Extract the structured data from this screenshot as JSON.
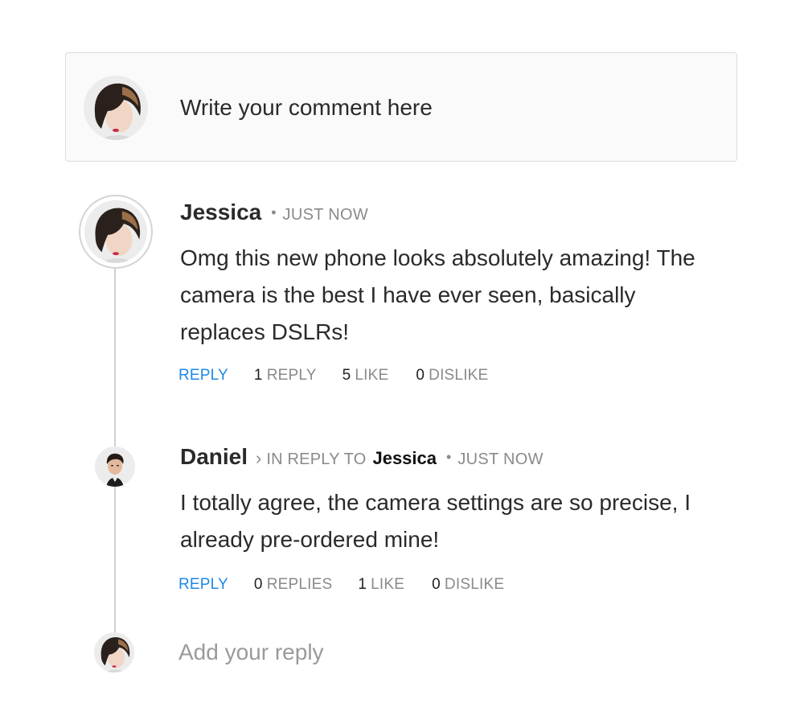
{
  "composer": {
    "placeholder": "Write your comment here",
    "avatar_icon": "jessica-avatar"
  },
  "comments": [
    {
      "author": "Jessica",
      "time": "JUST NOW",
      "body_lines": [
        "Omg this new phone looks absolutely amazing! The",
        "camera is the best I have ever seen, basically",
        "replaces DSLRs!"
      ],
      "reply_label": "REPLY",
      "replies_count": "1",
      "replies_label": "REPLY",
      "likes_count": "5",
      "likes_label": "LIKE",
      "dislikes_count": "0",
      "dislikes_label": "DISLIKE"
    },
    {
      "author": "Daniel",
      "in_reply_to_label": "IN REPLY TO",
      "in_reply_to": "Jessica",
      "time": "JUST NOW",
      "body_lines": [
        "I totally agree, the camera settings are so precise, I",
        "already pre-ordered mine!"
      ],
      "reply_label": "REPLY",
      "replies_count": "0",
      "replies_label": "REPLIES",
      "likes_count": "1",
      "likes_label": "LIKE",
      "dislikes_count": "0",
      "dislikes_label": "DISLIKE"
    }
  ],
  "reply_box": {
    "placeholder": "Add your reply"
  },
  "colors": {
    "accent": "#1e88e5",
    "muted": "#8a8a8a",
    "text": "#2a2a2a",
    "border": "#dcdcdc"
  }
}
